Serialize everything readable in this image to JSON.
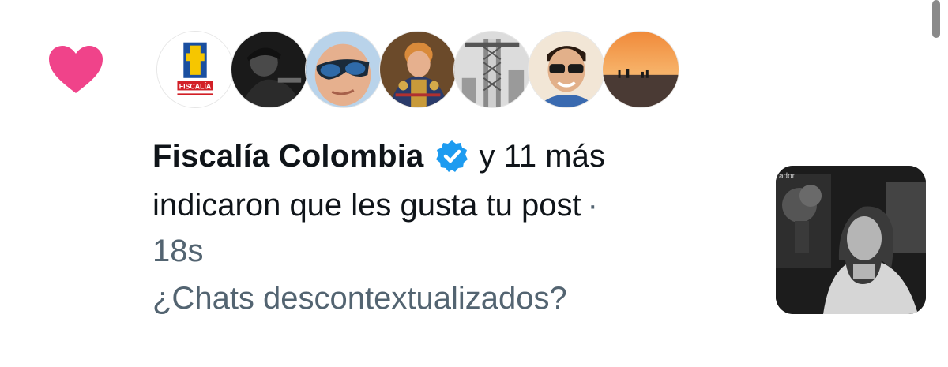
{
  "notification": {
    "type_icon": "heart-icon",
    "liker_name": "Fiscalía Colombia",
    "more_text": "y 11 más",
    "action_text": "indicaron que les gusta tu post",
    "separator": "·",
    "time": "18s",
    "post_snippet": "¿Chats descontextualizados?"
  },
  "avatars": [
    {
      "name": "fiscalia-logo-avatar",
      "logo_text": "FISCALÍA"
    },
    {
      "name": "man-in-cap-avatar"
    },
    {
      "name": "man-with-sunglasses-avatar"
    },
    {
      "name": "general-portrait-avatar"
    },
    {
      "name": "tower-crane-avatar"
    },
    {
      "name": "young-man-sunglasses-avatar"
    },
    {
      "name": "sunset-beach-avatar"
    }
  ],
  "thumbnail": {
    "caption_fragment": "ador"
  },
  "colors": {
    "heart": "#f0438a",
    "verified": "#1d9bf0",
    "primary_text": "#0f1419",
    "secondary_text": "#536471"
  }
}
